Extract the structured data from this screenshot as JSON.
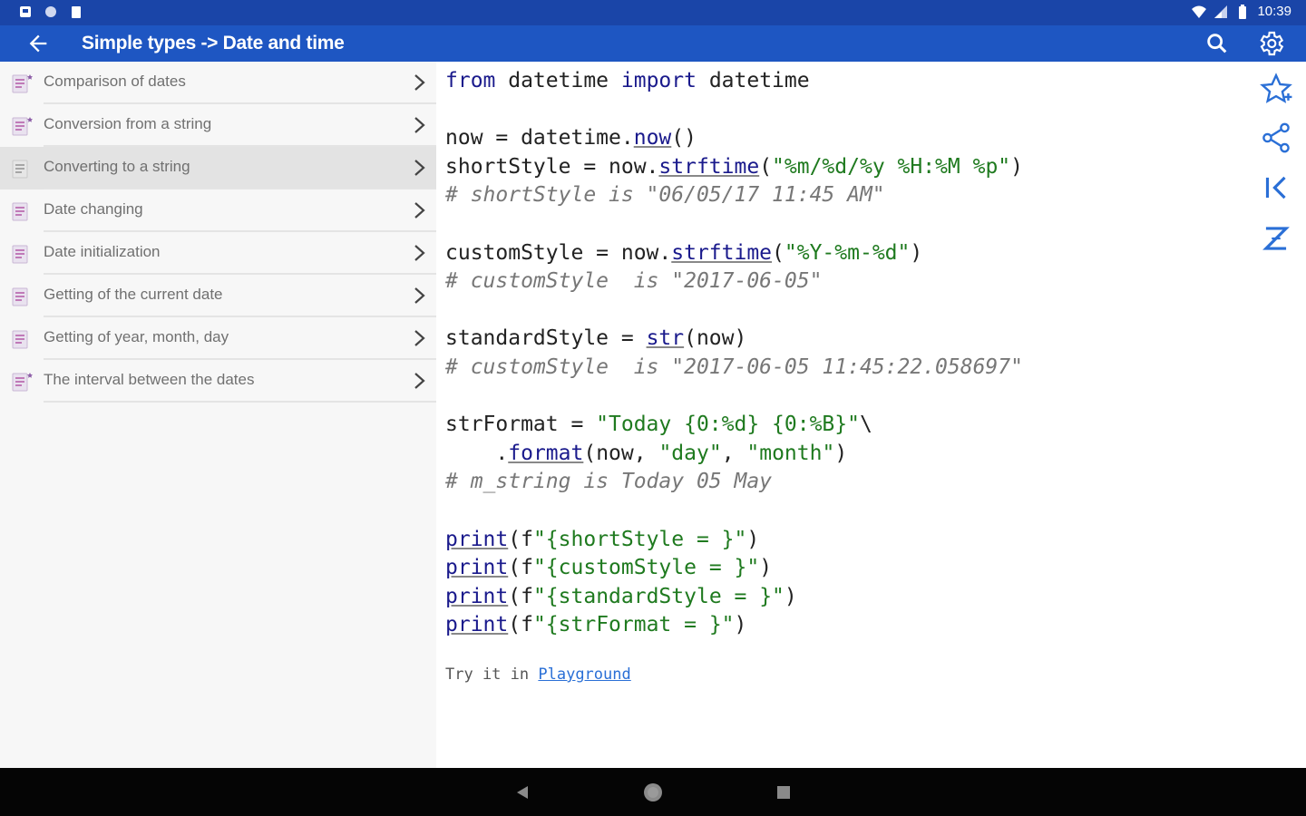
{
  "status_bar": {
    "time": "10:39",
    "icons": [
      "notification-icon",
      "circle-icon",
      "clipboard-icon",
      "wifi-icon",
      "signal-icon",
      "battery-icon"
    ]
  },
  "toolbar": {
    "title": "Simple types -> Date and time",
    "icons": [
      "back-arrow-icon",
      "search-icon",
      "gear-icon"
    ]
  },
  "sidebar": {
    "items": [
      {
        "label": "Comparison of dates",
        "starred": true
      },
      {
        "label": "Conversion from a string",
        "starred": true
      },
      {
        "label": "Converting to a string",
        "starred": false,
        "active": true
      },
      {
        "label": "Date changing",
        "starred": false
      },
      {
        "label": "Date initialization",
        "starred": false
      },
      {
        "label": "Getting of the current date",
        "starred": false
      },
      {
        "label": "Getting of year, month, day",
        "starred": false
      },
      {
        "label": "The interval between the dates",
        "starred": true
      }
    ]
  },
  "code": {
    "lines": [
      "from datetime import datetime",
      "",
      "now = datetime.now()",
      "shortStyle = now.strftime(\"%m/%d/%y %H:%M %p\")",
      "# shortStyle is \"06/05/17 11:45 AM\"",
      "",
      "customStyle = now.strftime(\"%Y-%m-%d\")",
      "# customStyle  is \"2017-06-05\"",
      "",
      "standardStyle = str(now)",
      "# customStyle  is \"2017-06-05 11:45:22.058697\"",
      "",
      "strFormat = \"Today {0:%d} {0:%B}\"\\",
      "    .format(now, \"day\", \"month\")",
      "# m_string is Today 05 May",
      "",
      "print(f\"{shortStyle = }\")",
      "print(f\"{customStyle = }\")",
      "print(f\"{standardStyle = }\")",
      "print(f\"{strFormat = }\")"
    ]
  },
  "try_it": {
    "prefix": "Try it in",
    "link": "Playground"
  },
  "side_tools": [
    "star-add-icon",
    "share-icon",
    "first-page-icon",
    "sort-z-icon"
  ],
  "nav_bar": [
    "back-triangle-icon",
    "home-circle-icon",
    "recents-square-icon"
  ],
  "colors": {
    "status_bar": "#1a45a8",
    "toolbar": "#1e56c2",
    "accent": "#2a6fd6",
    "keyword": "#1a1a8c",
    "string": "#1f7a1f",
    "comment": "#777777"
  }
}
